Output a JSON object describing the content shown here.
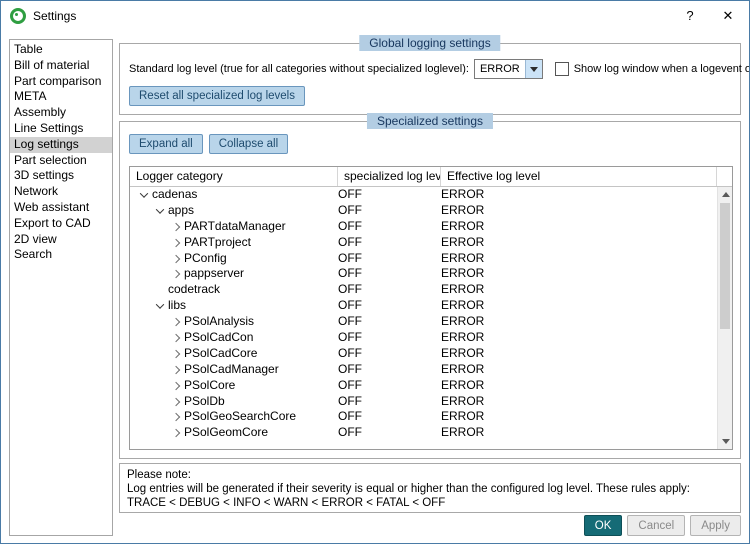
{
  "window": {
    "title": "Settings",
    "help_label": "?",
    "close_label": "✕"
  },
  "colors": {
    "accent_button_bg": "#b9d5ea",
    "accent_button_border": "#6a96bd",
    "group_title_bg": "#b3cde3",
    "ok_button_bg": "#156b76",
    "sidebar_selection_bg": "#d2d2d2",
    "app_icon_green": "#2f9e41"
  },
  "sidebar": {
    "items": [
      {
        "label": "Table",
        "selected": false
      },
      {
        "label": "Bill of material",
        "selected": false
      },
      {
        "label": "Part comparison",
        "selected": false
      },
      {
        "label": "META",
        "selected": false
      },
      {
        "label": "Assembly",
        "selected": false
      },
      {
        "label": "Line Settings",
        "selected": false
      },
      {
        "label": "Log settings",
        "selected": true
      },
      {
        "label": "Part selection",
        "selected": false
      },
      {
        "label": "3D settings",
        "selected": false
      },
      {
        "label": "Network",
        "selected": false
      },
      {
        "label": "Web assistant",
        "selected": false
      },
      {
        "label": "Export to CAD",
        "selected": false
      },
      {
        "label": "2D view",
        "selected": false
      },
      {
        "label": "Search",
        "selected": false
      }
    ]
  },
  "global_settings": {
    "title": "Global logging settings",
    "standard_label": "Standard log level (true for all categories without specialized loglevel):",
    "level_value": "ERROR",
    "checkbox_label": "Show log window when a logevent occur",
    "checkbox_checked": false,
    "reset_button": "Reset all specialized log levels"
  },
  "specialized": {
    "title": "Specialized settings",
    "expand_button": "Expand all",
    "collapse_button": "Collapse all",
    "columns": [
      "Logger category",
      "specialized log level",
      "Effective log level"
    ],
    "rows": [
      {
        "label": "cadenas",
        "level": 1,
        "state": "expanded",
        "specialized": "OFF",
        "effective": "ERROR"
      },
      {
        "label": "apps",
        "level": 2,
        "state": "expanded",
        "specialized": "OFF",
        "effective": "ERROR"
      },
      {
        "label": "PARTdataManager",
        "level": 3,
        "state": "collapsed",
        "specialized": "OFF",
        "effective": "ERROR"
      },
      {
        "label": "PARTproject",
        "level": 3,
        "state": "collapsed",
        "specialized": "OFF",
        "effective": "ERROR"
      },
      {
        "label": "PConfig",
        "level": 3,
        "state": "collapsed",
        "specialized": "OFF",
        "effective": "ERROR"
      },
      {
        "label": "pappserver",
        "level": 3,
        "state": "collapsed",
        "specialized": "OFF",
        "effective": "ERROR"
      },
      {
        "label": "codetrack",
        "level": 2,
        "state": "leaf",
        "specialized": "OFF",
        "effective": "ERROR"
      },
      {
        "label": "libs",
        "level": 2,
        "state": "expanded",
        "specialized": "OFF",
        "effective": "ERROR"
      },
      {
        "label": "PSolAnalysis",
        "level": 3,
        "state": "collapsed",
        "specialized": "OFF",
        "effective": "ERROR"
      },
      {
        "label": "PSolCadCon",
        "level": 3,
        "state": "collapsed",
        "specialized": "OFF",
        "effective": "ERROR"
      },
      {
        "label": "PSolCadCore",
        "level": 3,
        "state": "collapsed",
        "specialized": "OFF",
        "effective": "ERROR"
      },
      {
        "label": "PSolCadManager",
        "level": 3,
        "state": "collapsed",
        "specialized": "OFF",
        "effective": "ERROR"
      },
      {
        "label": "PSolCore",
        "level": 3,
        "state": "collapsed",
        "specialized": "OFF",
        "effective": "ERROR"
      },
      {
        "label": "PSolDb",
        "level": 3,
        "state": "collapsed",
        "specialized": "OFF",
        "effective": "ERROR"
      },
      {
        "label": "PSolGeoSearchCore",
        "level": 3,
        "state": "collapsed",
        "specialized": "OFF",
        "effective": "ERROR"
      },
      {
        "label": "PSolGeomCore",
        "level": 3,
        "state": "collapsed",
        "specialized": "OFF",
        "effective": "ERROR"
      }
    ]
  },
  "note": {
    "line1": "Please note:",
    "line2": "Log entries will be generated if their severity is equal or higher than the configured log level. These rules apply:",
    "line3": "TRACE < DEBUG < INFO < WARN < ERROR < FATAL < OFF"
  },
  "footer": {
    "ok": "OK",
    "cancel": "Cancel",
    "apply": "Apply"
  }
}
